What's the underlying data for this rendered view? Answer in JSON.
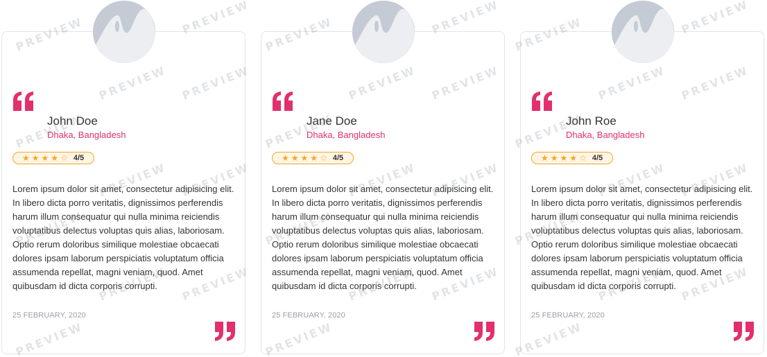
{
  "watermark": "PREVIEW",
  "colors": {
    "accent": "#e1306c",
    "star": "#f4a62a",
    "border": "#e2e4ea"
  },
  "cards": [
    {
      "name": "John Doe",
      "location": "Dhaka, Bangladesh",
      "rating_text": "4/5",
      "rating": 4,
      "rating_max": 5,
      "text": "Lorem ipsum dolor sit amet, consectetur adipisicing elit. In libero dicta porro veritatis, dignissimos perferendis harum illum consequatur qui nulla minima reiciendis voluptatibus delectus voluptas quis alias, laboriosam. Optio rerum doloribus similique molestiae obcaecati dolores ipsam laborum perspiciatis voluptatum officia assumenda repellat, magni veniam, quod. Amet quibusdam id dicta corporis corrupti.",
      "date": "25 FEBRUARY, 2020",
      "avatar_icon": "image-placeholder-icon"
    },
    {
      "name": "Jane Doe",
      "location": "Dhaka, Bangladesh",
      "rating_text": "4/5",
      "rating": 4,
      "rating_max": 5,
      "text": "Lorem ipsum dolor sit amet, consectetur adipisicing elit. In libero dicta porro veritatis, dignissimos perferendis harum illum consequatur qui nulla minima reiciendis voluptatibus delectus voluptas quis alias, laboriosam. Optio rerum doloribus similique molestiae obcaecati dolores ipsam laborum perspiciatis voluptatum officia assumenda repellat, magni veniam, quod. Amet quibusdam id dicta corporis corrupti.",
      "date": "25 FEBRUARY, 2020",
      "avatar_icon": "image-placeholder-icon"
    },
    {
      "name": "John Roe",
      "location": "Dhaka, Bangladesh",
      "rating_text": "4/5",
      "rating": 4,
      "rating_max": 5,
      "text": "Lorem ipsum dolor sit amet, consectetur adipisicing elit. In libero dicta porro veritatis, dignissimos perferendis harum illum consequatur qui nulla minima reiciendis voluptatibus delectus voluptas quis alias, laboriosam. Optio rerum doloribus similique molestiae obcaecati dolores ipsam laborum perspiciatis voluptatum officia assumenda repellat, magni veniam, quod. Amet quibusdam id dicta corporis corrupti.",
      "date": "25 FEBRUARY, 2020",
      "avatar_icon": "image-placeholder-icon"
    }
  ]
}
